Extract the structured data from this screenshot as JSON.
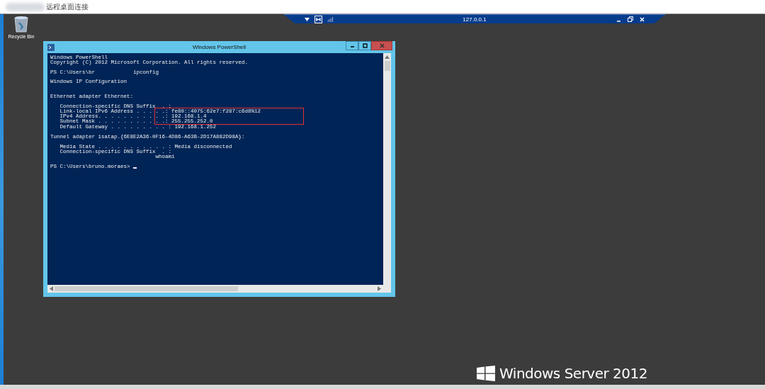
{
  "app_window": {
    "title": "远程桌面连接"
  },
  "desktop_icons": [
    {
      "label": "Recycle Bin"
    }
  ],
  "connection_bar": {
    "title": "127.0.0.1"
  },
  "powershell": {
    "title": "Windows PowerShell",
    "lines": [
      {
        "kind": "text",
        "text": "Windows PowerShell"
      },
      {
        "kind": "text",
        "text": "Copyright (C) 2012 Microsoft Corporation. All rights reserved."
      },
      {
        "kind": "blank"
      },
      {
        "kind": "text",
        "text": "PS C:\\Users\\br            ipconfig"
      },
      {
        "kind": "blank"
      },
      {
        "kind": "text",
        "text": "Windows IP Configuration"
      },
      {
        "kind": "blank"
      },
      {
        "kind": "blank"
      },
      {
        "kind": "text",
        "text": "Ethernet adapter Ethernet:"
      },
      {
        "kind": "blank"
      },
      {
        "kind": "text",
        "text": "   Connection-specific DNS Suffix  . :"
      },
      {
        "kind": "pair",
        "label": "   Link-local IPv6 Address . . . . .",
        "value": ": fe80::4075:62e7:f287:c6d8%12",
        "highlighted": true
      },
      {
        "kind": "pair",
        "label": "   IPv4 Address. . . . . . . . . . .",
        "value": ": 192.168.1.4",
        "highlighted": true
      },
      {
        "kind": "pair",
        "label": "   Subnet Mask . . . . . . . . . . .",
        "value": ": 255.255.252.0",
        "highlighted": true
      },
      {
        "kind": "pair",
        "label": "   Default Gateway . . . . . . . . .",
        "value": ": 192.168.1.252",
        "highlighted": false
      },
      {
        "kind": "blank"
      },
      {
        "kind": "text",
        "text": "Tunnel adapter isatap.{6E8E2A36-0F16-4D86-A63B-2D17A882D98A}:"
      },
      {
        "kind": "blank"
      },
      {
        "kind": "text",
        "text": "   Media State . . . . . . . . . . . : Media disconnected"
      },
      {
        "kind": "text",
        "text": "   Connection-specific DNS Suffix  . :"
      },
      {
        "kind": "text",
        "text": "                                 whoami"
      },
      {
        "kind": "blank"
      },
      {
        "kind": "prompt",
        "text": "PS C:\\Users\\bruno.moraes> "
      }
    ]
  },
  "branding": {
    "text": "Windows Server 2012"
  }
}
